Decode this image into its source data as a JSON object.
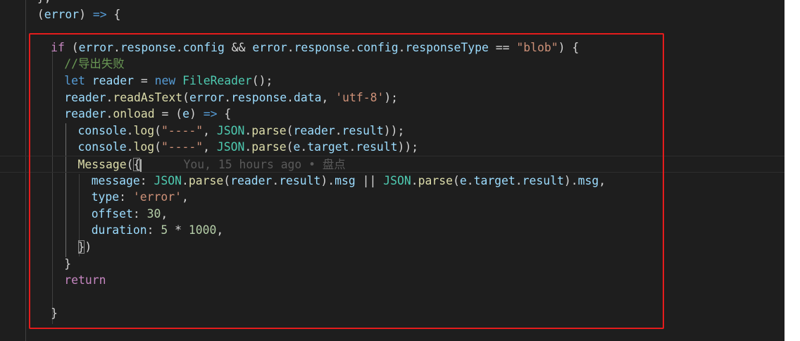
{
  "editor": {
    "lines": [
      {
        "id": "l0",
        "indent": 4,
        "tokens": [
          {
            "t": "}",
            "c": "p"
          },
          {
            "t": ",",
            "c": "p"
          }
        ]
      },
      {
        "id": "l1",
        "indent": 4,
        "tokens": [
          {
            "t": "(",
            "c": "p"
          },
          {
            "t": "error",
            "c": "v"
          },
          {
            "t": ") ",
            "c": "p"
          },
          {
            "t": "=>",
            "c": "k"
          },
          {
            "t": " {",
            "c": "p"
          }
        ]
      },
      {
        "id": "l2",
        "indent": 6,
        "tokens": []
      },
      {
        "id": "l3",
        "indent": 6,
        "tokens": [
          {
            "t": "if",
            "c": "kc"
          },
          {
            "t": " (",
            "c": "p"
          },
          {
            "t": "error",
            "c": "v"
          },
          {
            "t": ".",
            "c": "p"
          },
          {
            "t": "response",
            "c": "v"
          },
          {
            "t": ".",
            "c": "p"
          },
          {
            "t": "config",
            "c": "v"
          },
          {
            "t": " && ",
            "c": "p"
          },
          {
            "t": "error",
            "c": "v"
          },
          {
            "t": ".",
            "c": "p"
          },
          {
            "t": "response",
            "c": "v"
          },
          {
            "t": ".",
            "c": "p"
          },
          {
            "t": "config",
            "c": "v"
          },
          {
            "t": ".",
            "c": "p"
          },
          {
            "t": "responseType",
            "c": "v"
          },
          {
            "t": " == ",
            "c": "p"
          },
          {
            "t": "\"blob\"",
            "c": "s"
          },
          {
            "t": ") {",
            "c": "p"
          }
        ]
      },
      {
        "id": "l4",
        "indent": 8,
        "tokens": [
          {
            "t": "//导出失败",
            "c": "cm"
          }
        ]
      },
      {
        "id": "l5",
        "indent": 8,
        "tokens": [
          {
            "t": "let",
            "c": "k"
          },
          {
            "t": " ",
            "c": "p"
          },
          {
            "t": "reader",
            "c": "v"
          },
          {
            "t": " = ",
            "c": "p"
          },
          {
            "t": "new",
            "c": "k"
          },
          {
            "t": " ",
            "c": "p"
          },
          {
            "t": "FileReader",
            "c": "c"
          },
          {
            "t": "();",
            "c": "p"
          }
        ]
      },
      {
        "id": "l6",
        "indent": 8,
        "tokens": [
          {
            "t": "reader",
            "c": "v"
          },
          {
            "t": ".",
            "c": "p"
          },
          {
            "t": "readAsText",
            "c": "f"
          },
          {
            "t": "(",
            "c": "p"
          },
          {
            "t": "error",
            "c": "v"
          },
          {
            "t": ".",
            "c": "p"
          },
          {
            "t": "response",
            "c": "v"
          },
          {
            "t": ".",
            "c": "p"
          },
          {
            "t": "data",
            "c": "v"
          },
          {
            "t": ", ",
            "c": "p"
          },
          {
            "t": "'utf-8'",
            "c": "s"
          },
          {
            "t": ");",
            "c": "p"
          }
        ]
      },
      {
        "id": "l7",
        "indent": 8,
        "tokens": [
          {
            "t": "reader",
            "c": "v"
          },
          {
            "t": ".",
            "c": "p"
          },
          {
            "t": "onload",
            "c": "f"
          },
          {
            "t": " = (",
            "c": "p"
          },
          {
            "t": "e",
            "c": "v"
          },
          {
            "t": ") ",
            "c": "p"
          },
          {
            "t": "=>",
            "c": "k"
          },
          {
            "t": " {",
            "c": "p"
          }
        ]
      },
      {
        "id": "l8",
        "indent": 10,
        "tokens": [
          {
            "t": "console",
            "c": "v"
          },
          {
            "t": ".",
            "c": "p"
          },
          {
            "t": "log",
            "c": "f"
          },
          {
            "t": "(",
            "c": "p"
          },
          {
            "t": "\"----\"",
            "c": "s"
          },
          {
            "t": ", ",
            "c": "p"
          },
          {
            "t": "JSON",
            "c": "c"
          },
          {
            "t": ".",
            "c": "p"
          },
          {
            "t": "parse",
            "c": "f"
          },
          {
            "t": "(",
            "c": "p"
          },
          {
            "t": "reader",
            "c": "v"
          },
          {
            "t": ".",
            "c": "p"
          },
          {
            "t": "result",
            "c": "v"
          },
          {
            "t": "));",
            "c": "p"
          }
        ]
      },
      {
        "id": "l9",
        "indent": 10,
        "tokens": [
          {
            "t": "console",
            "c": "v"
          },
          {
            "t": ".",
            "c": "p"
          },
          {
            "t": "log",
            "c": "f"
          },
          {
            "t": "(",
            "c": "p"
          },
          {
            "t": "\"----\"",
            "c": "s"
          },
          {
            "t": ", ",
            "c": "p"
          },
          {
            "t": "JSON",
            "c": "c"
          },
          {
            "t": ".",
            "c": "p"
          },
          {
            "t": "parse",
            "c": "f"
          },
          {
            "t": "(",
            "c": "p"
          },
          {
            "t": "e",
            "c": "v"
          },
          {
            "t": ".",
            "c": "p"
          },
          {
            "t": "target",
            "c": "v"
          },
          {
            "t": ".",
            "c": "p"
          },
          {
            "t": "result",
            "c": "v"
          },
          {
            "t": "));",
            "c": "p"
          }
        ]
      },
      {
        "id": "l10",
        "indent": 10,
        "current": true,
        "tokens": [
          {
            "t": "Message",
            "c": "f"
          },
          {
            "t": "(",
            "c": "p"
          },
          {
            "t": "{",
            "c": "p",
            "match": true
          },
          {
            "t": "CURSOR",
            "c": "cursor"
          },
          {
            "t": "      You, 15 hours ago • 盘点",
            "c": "blame"
          }
        ]
      },
      {
        "id": "l11",
        "indent": 12,
        "tokens": [
          {
            "t": "message",
            "c": "v"
          },
          {
            "t": ": ",
            "c": "p"
          },
          {
            "t": "JSON",
            "c": "c"
          },
          {
            "t": ".",
            "c": "p"
          },
          {
            "t": "parse",
            "c": "f"
          },
          {
            "t": "(",
            "c": "p"
          },
          {
            "t": "reader",
            "c": "v"
          },
          {
            "t": ".",
            "c": "p"
          },
          {
            "t": "result",
            "c": "v"
          },
          {
            "t": ").",
            "c": "p"
          },
          {
            "t": "msg",
            "c": "v"
          },
          {
            "t": " || ",
            "c": "p"
          },
          {
            "t": "JSON",
            "c": "c"
          },
          {
            "t": ".",
            "c": "p"
          },
          {
            "t": "parse",
            "c": "f"
          },
          {
            "t": "(",
            "c": "p"
          },
          {
            "t": "e",
            "c": "v"
          },
          {
            "t": ".",
            "c": "p"
          },
          {
            "t": "target",
            "c": "v"
          },
          {
            "t": ".",
            "c": "p"
          },
          {
            "t": "result",
            "c": "v"
          },
          {
            "t": ").",
            "c": "p"
          },
          {
            "t": "msg",
            "c": "v"
          },
          {
            "t": ",",
            "c": "p"
          }
        ]
      },
      {
        "id": "l12",
        "indent": 12,
        "tokens": [
          {
            "t": "type",
            "c": "v"
          },
          {
            "t": ": ",
            "c": "p"
          },
          {
            "t": "'error'",
            "c": "s"
          },
          {
            "t": ",",
            "c": "p"
          }
        ]
      },
      {
        "id": "l13",
        "indent": 12,
        "tokens": [
          {
            "t": "offset",
            "c": "v"
          },
          {
            "t": ": ",
            "c": "p"
          },
          {
            "t": "30",
            "c": "n"
          },
          {
            "t": ",",
            "c": "p"
          }
        ]
      },
      {
        "id": "l14",
        "indent": 12,
        "tokens": [
          {
            "t": "duration",
            "c": "v"
          },
          {
            "t": ": ",
            "c": "p"
          },
          {
            "t": "5",
            "c": "n"
          },
          {
            "t": " * ",
            "c": "p"
          },
          {
            "t": "1000",
            "c": "n"
          },
          {
            "t": ",",
            "c": "p"
          }
        ]
      },
      {
        "id": "l15",
        "indent": 10,
        "tokens": [
          {
            "t": "}",
            "c": "p",
            "match": true
          },
          {
            "t": ")",
            "c": "p"
          }
        ]
      },
      {
        "id": "l16",
        "indent": 8,
        "tokens": [
          {
            "t": "}",
            "c": "p"
          }
        ]
      },
      {
        "id": "l17",
        "indent": 8,
        "tokens": [
          {
            "t": "return",
            "c": "kc"
          }
        ]
      },
      {
        "id": "l18",
        "indent": 8,
        "tokens": []
      },
      {
        "id": "l19",
        "indent": 6,
        "tokens": [
          {
            "t": "}",
            "c": "p"
          }
        ]
      }
    ]
  },
  "annotation": {
    "type": "red-rectangle",
    "color": "#e51c1c"
  }
}
